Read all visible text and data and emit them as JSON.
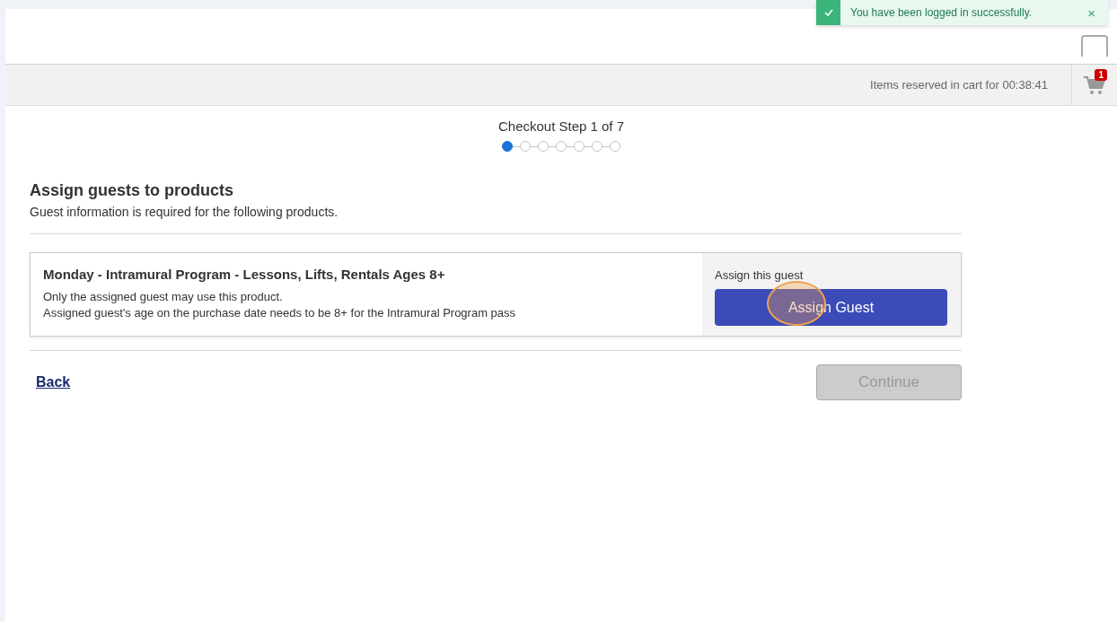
{
  "toast": {
    "message": "You have been logged in successfully.",
    "close": "×"
  },
  "cart_bar": {
    "timer_text": "Items reserved in cart for 00:38:41",
    "cart_count": "1"
  },
  "stepper": {
    "title": "Checkout Step 1 of 7",
    "steps": [
      {
        "selected": true
      },
      {
        "selected": false
      },
      {
        "selected": false
      },
      {
        "selected": false
      },
      {
        "selected": false
      },
      {
        "selected": false
      },
      {
        "selected": false
      }
    ]
  },
  "section": {
    "title": "Assign guests to products",
    "subtitle": "Guest information is required for the following products."
  },
  "products": [
    {
      "name": "Monday - Intramural Program - Lessons, Lifts, Rentals Ages 8+",
      "notes": [
        "Only the assigned guest may use this product.",
        "Assigned guest's age on the purchase date needs to be 8+ for the Intramural Program pass"
      ],
      "assign_label": "Assign this guest",
      "assign_button": "Assign Guest"
    }
  ],
  "footer": {
    "back": "Back",
    "continue": {
      "label": "Continue",
      "disabled": true
    }
  }
}
